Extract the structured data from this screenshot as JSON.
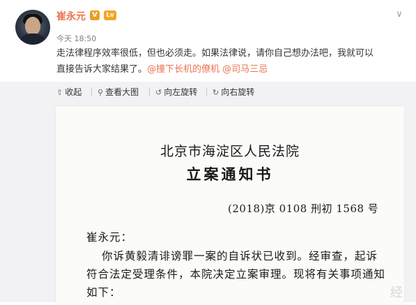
{
  "post": {
    "username": "崔永元",
    "verified_badge": "V",
    "level_badge": "Lv",
    "timestamp": "今天 18:50",
    "text_line1": "走法律程序效率很低，但也必须走。如果法律说，请你自己想办法吧，我就可以",
    "text_line2_plain": "直接告诉大家结果了。",
    "mention1": "@撞下长机的僚机",
    "mention2": "@司马三忌",
    "menu_icon": "chevron-down-icon"
  },
  "toolbar": {
    "collapse": "收起",
    "view_large": "查看大图",
    "rotate_left": "向左旋转",
    "rotate_right": "向右旋转"
  },
  "document": {
    "court": "北京市海淀区人民法院",
    "title": "立案通知书",
    "case_number": "(2018)京 0108 刑初 1568 号",
    "addressee": "崔永元：",
    "body_line1": "你诉黄毅清诽谤罪一案的自诉状已收到。经审查，起诉",
    "body_line2": "符合法定受理条件，本院决定立案审理。现将有关事项通知",
    "body_line3": "如下："
  },
  "watermark": "经"
}
